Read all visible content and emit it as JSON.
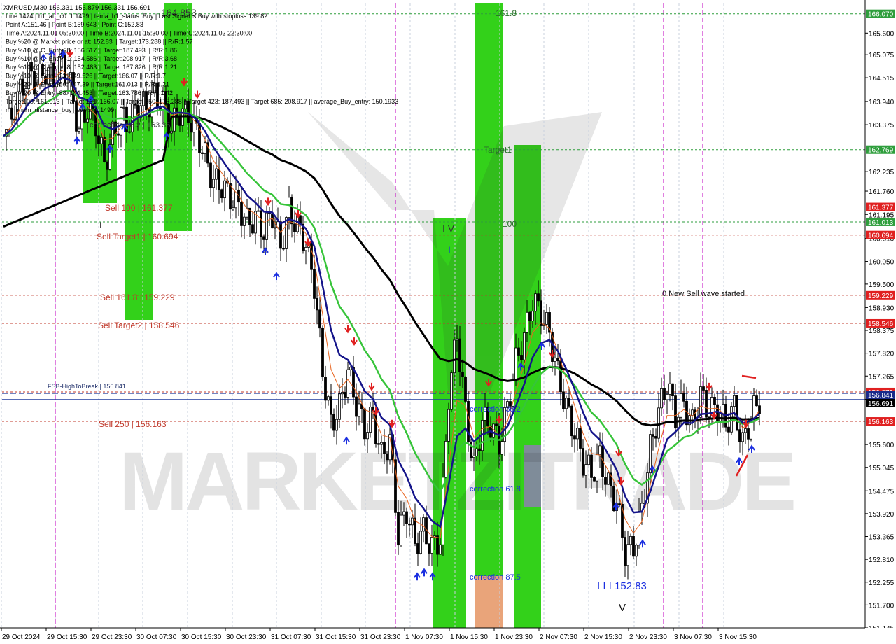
{
  "header": {
    "symbol_line": "XMRUSD,M30  156.331 156.879 156.331 156.691",
    "lines": [
      "Line:1474 | h1_atr_c0: 1.1499 | tema_h1_status: Buy | Last Signal is:Buy with stoploss:139.82",
      "Point A:151.46 | Point B:159.643 | Point C:152.83",
      "Time A:2024.11.01 05:30:00 | Time B:2024.11.01 15:30:00 | Time C:2024.11.02 22:30:00",
      "Buy %20 @ Market price or at: 152.83 || Target:173.288 || R/R:1.57",
      "Buy %10 @ C_Entry38: 156.517 || Target:187.493 || R/R:1.86",
      "Buy %10 @ C_Entry61: 154.586 || Target:208.917 || R/R:3.68",
      "Buy %10 @ C_Entry88: 152.483 || Target:167.826 || R/R:1.21",
      "Buy %10 @ Entry -23: 149.526 || Target:166.07 || R/R:1.7",
      "Buy %20 @ Entry -50: 147.39 || Target:161.013 || R/R:1.21",
      "Buy %20 @ Entry -88: 144.453 || Target:163.786 || R/R:1.42",
      "Target100: 161.013 || Target 161: 166.07 || Target 250: 173.288 || Target 423: 187.493 || Target 685: 208.917 || average_Buy_entry: 150.1933",
      "minimum_distance_buy_levels: 1.1499"
    ]
  },
  "watermark": "MARKETZITRADE",
  "colors": {
    "price_box_green": "#2e9e3c",
    "price_box_red": "#e02020",
    "price_box_blue": "#1a2a8a",
    "zone_green": "#33d11a",
    "zone_orange": "#e9a47a",
    "zone_gray": "#7f8c99",
    "ema_black": "#000000",
    "ema_green": "#37c43a",
    "ema_navy": "#14148a",
    "level_red": "#c0392b",
    "fsb_blue": "#1f3a9e"
  },
  "chart_data": {
    "type": "candlestick",
    "symbol": "XMRUSD",
    "timeframe": "M30",
    "ylim": [
      151.145,
      166.32
    ],
    "y_ticks": [
      "165.600",
      "165.075",
      "164.515",
      "163.940",
      "163.375",
      "162.235",
      "161.760",
      "161.195",
      "160.610",
      "160.050",
      "159.500",
      "158.930",
      "158.375",
      "157.820",
      "157.265",
      "156.701",
      "155.600",
      "155.045",
      "154.475",
      "153.920",
      "153.365",
      "152.810",
      "152.255",
      "151.700",
      "151.145"
    ],
    "x_ticks": [
      "29 Oct 2024",
      "29 Oct 15:30",
      "29 Oct 23:30",
      "30 Oct 07:30",
      "30 Oct 15:30",
      "30 Oct 23:30",
      "31 Oct 07:30",
      "31 Oct 15:30",
      "31 Oct 23:30",
      "1 Nov 07:30",
      "1 Nov 15:30",
      "1 Nov 23:30",
      "2 Nov 07:30",
      "2 Nov 15:30",
      "2 Nov 23:30",
      "3 Nov 07:30",
      "3 Nov 15:30"
    ],
    "price_boxes": [
      {
        "label": "166.070",
        "value": 166.07,
        "color": "green"
      },
      {
        "label": "162.769",
        "value": 162.769,
        "color": "green"
      },
      {
        "label": "161.377",
        "value": 161.377,
        "color": "red"
      },
      {
        "label": "161.013",
        "value": 161.013,
        "color": "green"
      },
      {
        "label": "160.694",
        "value": 160.694,
        "color": "red"
      },
      {
        "label": "159.229",
        "value": 159.229,
        "color": "red"
      },
      {
        "label": "158.546",
        "value": 158.546,
        "color": "red"
      },
      {
        "label": "156.879",
        "value": 156.879,
        "color": "red"
      },
      {
        "label": "156.841",
        "value": 156.841,
        "color": "blue"
      },
      {
        "label": "156.691",
        "value": 156.691,
        "color": "black"
      },
      {
        "label": "156.163",
        "value": 156.163,
        "color": "red"
      }
    ],
    "levels": [
      {
        "label": "Sell 100 | 161.377",
        "value": 161.377
      },
      {
        "label": "Sell Target1 | 160.694",
        "value": 160.694
      },
      {
        "label": "Sell 161.8 | 159.229",
        "value": 159.229
      },
      {
        "label": "Sell Target2 | 158.546",
        "value": 158.546
      },
      {
        "label": "Sell  250 | 156.163",
        "value": 156.163
      },
      {
        "label": "FSB-HighToBreak | 156.841",
        "value": 156.841
      }
    ],
    "annotations": [
      "0 New Sell wave started",
      "correction 38.2 | 163.35",
      "correction 87.5",
      "correction 61.8",
      "correction 38.2",
      "I I I 152.83",
      "I V",
      "I",
      "V",
      "161.8",
      "100",
      "Target1",
      "164.853"
    ],
    "close_path": [
      [
        0,
        163.1
      ],
      [
        12,
        163.6
      ],
      [
        24,
        164.2
      ],
      [
        36,
        164.6
      ],
      [
        48,
        164.4
      ],
      [
        60,
        164.7
      ],
      [
        72,
        164.5
      ],
      [
        84,
        164.9
      ],
      [
        96,
        164.3
      ],
      [
        108,
        163.2
      ],
      [
        120,
        163.8
      ],
      [
        132,
        163.4
      ],
      [
        144,
        162.4
      ],
      [
        156,
        163.1
      ],
      [
        168,
        163.6
      ],
      [
        180,
        163.4
      ],
      [
        192,
        163.9
      ],
      [
        204,
        163.8
      ],
      [
        216,
        164.1
      ],
      [
        228,
        163.9
      ],
      [
        240,
        163.3
      ],
      [
        252,
        163.7
      ],
      [
        264,
        163.6
      ],
      [
        276,
        163.2
      ],
      [
        288,
        162.6
      ],
      [
        300,
        162.0
      ],
      [
        312,
        161.9
      ],
      [
        324,
        161.6
      ],
      [
        336,
        161.4
      ],
      [
        348,
        161.0
      ],
      [
        360,
        161.1
      ],
      [
        372,
        160.8
      ],
      [
        384,
        161.2
      ],
      [
        396,
        160.4
      ],
      [
        408,
        161.3
      ],
      [
        420,
        160.9
      ],
      [
        432,
        160.5
      ],
      [
        444,
        159.5
      ],
      [
        456,
        157.4
      ],
      [
        468,
        156.1
      ],
      [
        480,
        156.5
      ],
      [
        492,
        157.4
      ],
      [
        504,
        156.6
      ],
      [
        516,
        156.0
      ],
      [
        528,
        156.3
      ],
      [
        540,
        155.3
      ],
      [
        552,
        155.7
      ],
      [
        564,
        153.4
      ],
      [
        576,
        154.0
      ],
      [
        588,
        153.2
      ],
      [
        600,
        153.5
      ],
      [
        612,
        153.1
      ],
      [
        624,
        153.3
      ],
      [
        636,
        156.8
      ],
      [
        648,
        158.3
      ],
      [
        660,
        156.4
      ],
      [
        672,
        155.0
      ],
      [
        684,
        156.2
      ],
      [
        696,
        156.1
      ],
      [
        708,
        155.6
      ],
      [
        720,
        156.5
      ],
      [
        732,
        157.6
      ],
      [
        744,
        158.2
      ],
      [
        756,
        159.1
      ],
      [
        768,
        158.8
      ],
      [
        780,
        158.3
      ],
      [
        792,
        157.3
      ],
      [
        804,
        156.5
      ],
      [
        816,
        155.9
      ],
      [
        828,
        155.2
      ],
      [
        840,
        154.9
      ],
      [
        852,
        155.3
      ],
      [
        864,
        154.6
      ],
      [
        876,
        154.2
      ],
      [
        888,
        153.0
      ],
      [
        900,
        153.1
      ],
      [
        912,
        154.0
      ],
      [
        924,
        155.5
      ],
      [
        936,
        156.4
      ],
      [
        948,
        157.1
      ],
      [
        960,
        156.3
      ],
      [
        972,
        156.6
      ],
      [
        984,
        156.1
      ],
      [
        996,
        156.8
      ],
      [
        1008,
        156.4
      ],
      [
        1020,
        156.5
      ],
      [
        1032,
        156.1
      ],
      [
        1044,
        156.5
      ],
      [
        1056,
        155.6
      ],
      [
        1068,
        156.3
      ],
      [
        1080,
        156.7
      ]
    ]
  }
}
